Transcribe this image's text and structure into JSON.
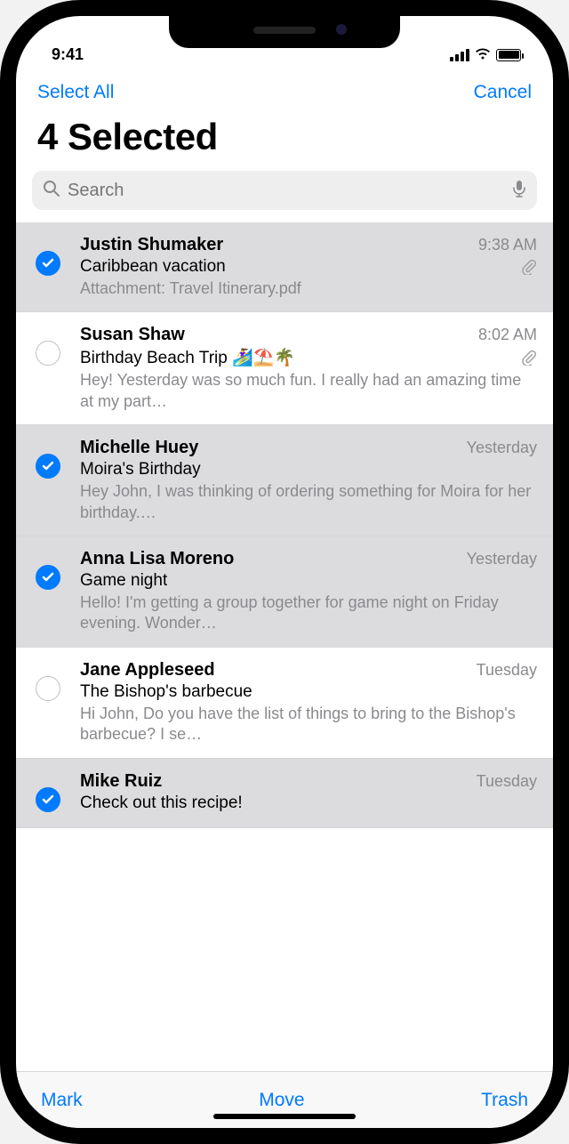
{
  "status": {
    "time": "9:41"
  },
  "nav": {
    "select_all": "Select All",
    "cancel": "Cancel"
  },
  "title": "4 Selected",
  "search": {
    "placeholder": "Search"
  },
  "toolbar": {
    "mark": "Mark",
    "move": "Move",
    "trash": "Trash"
  },
  "emails": [
    {
      "sender": "Justin Shumaker",
      "time": "9:38 AM",
      "subject": "Caribbean vacation",
      "preview": "Attachment: Travel Itinerary.pdf",
      "selected": true,
      "attachment": true
    },
    {
      "sender": "Susan Shaw",
      "time": "8:02 AM",
      "subject": "Birthday Beach Trip 🏄‍♀️⛱️🌴",
      "preview": "Hey! Yesterday was so much fun. I really had an amazing time at my part…",
      "selected": false,
      "attachment": true
    },
    {
      "sender": "Michelle Huey",
      "time": "Yesterday",
      "subject": "Moira's Birthday",
      "preview": "Hey John, I was thinking of ordering something for Moira for her birthday.…",
      "selected": true,
      "attachment": false
    },
    {
      "sender": "Anna Lisa Moreno",
      "time": "Yesterday",
      "subject": "Game night",
      "preview": "Hello! I'm getting a group together for game night on Friday evening. Wonder…",
      "selected": true,
      "attachment": false
    },
    {
      "sender": "Jane Appleseed",
      "time": "Tuesday",
      "subject": "The Bishop's barbecue",
      "preview": "Hi John, Do you have the list of things to bring to the Bishop's barbecue? I se…",
      "selected": false,
      "attachment": false
    },
    {
      "sender": "Mike Ruiz",
      "time": "Tuesday",
      "subject": "Check out this recipe!",
      "preview": "",
      "selected": true,
      "attachment": false
    }
  ]
}
